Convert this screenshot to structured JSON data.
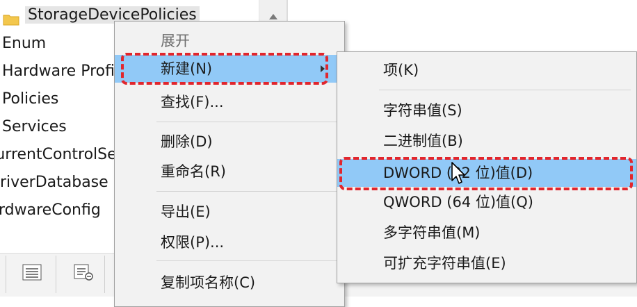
{
  "tree": {
    "items": [
      {
        "label": "StorageDevicePolicies"
      },
      {
        "label": "Enum"
      },
      {
        "label": "Hardware Profiles"
      },
      {
        "label": "Policies"
      },
      {
        "label": "Services"
      },
      {
        "label": "CurrentControlSet"
      },
      {
        "label": "DriverDatabase"
      },
      {
        "label": "HardwareConfig"
      }
    ]
  },
  "context_menu": {
    "items": [
      {
        "label": "展开"
      },
      {
        "label": "新建(N)"
      },
      {
        "label": "查找(F)..."
      },
      {
        "label": "删除(D)"
      },
      {
        "label": "重命名(R)"
      },
      {
        "label": "导出(E)"
      },
      {
        "label": "权限(P)..."
      },
      {
        "label": "复制项名称(C)"
      }
    ]
  },
  "submenu": {
    "items": [
      {
        "label": "项(K)"
      },
      {
        "label": "字符串值(S)"
      },
      {
        "label": "二进制值(B)"
      },
      {
        "label": "DWORD (32 位)值(D)"
      },
      {
        "label": "QWORD (64 位)值(Q)"
      },
      {
        "label": "多字符串值(M)"
      },
      {
        "label": "可扩充字符串值(E)"
      }
    ]
  },
  "colors": {
    "highlight": "#91c9f7",
    "annotation": "#e1262d",
    "menu_bg": "#f2f2f2"
  }
}
